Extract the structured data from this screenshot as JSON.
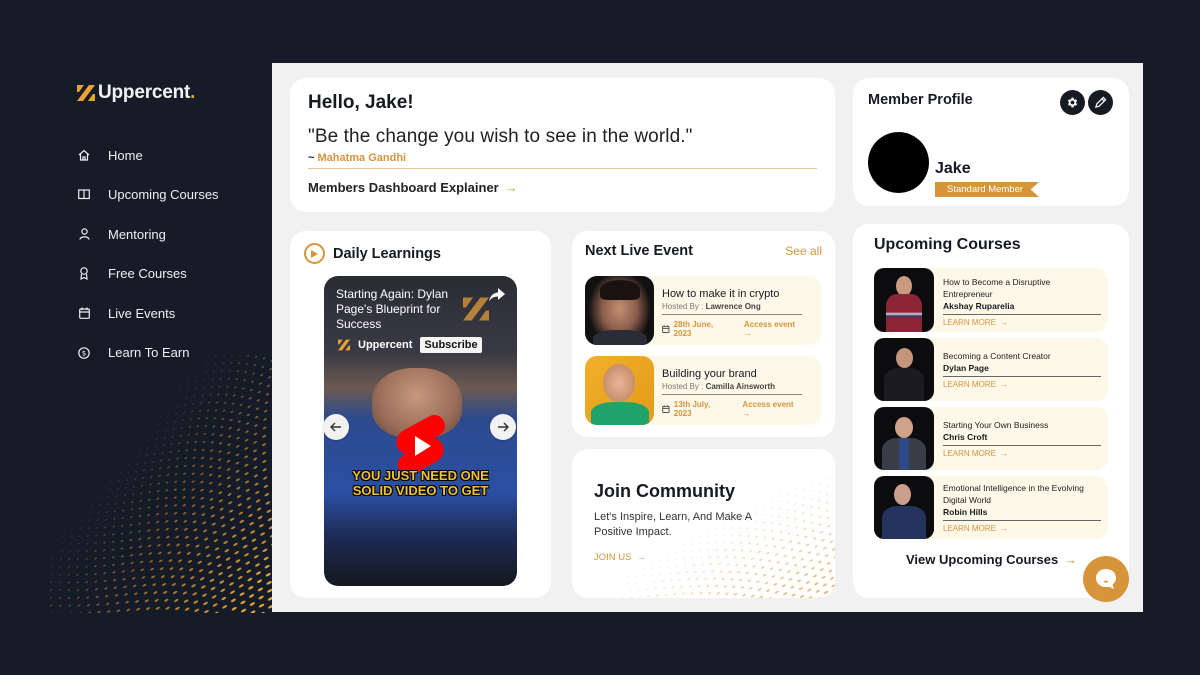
{
  "brand": {
    "name": "Uppercent",
    "accent": "#d7953b",
    "dark": "#161c27"
  },
  "sidebar": {
    "items": [
      {
        "label": "Home",
        "icon": "home-icon"
      },
      {
        "label": "Upcoming Courses",
        "icon": "book-icon"
      },
      {
        "label": "Mentoring",
        "icon": "user-icon"
      },
      {
        "label": "Free Courses",
        "icon": "award-icon"
      },
      {
        "label": "Live Events",
        "icon": "calendar-icon"
      },
      {
        "label": "Learn To Earn",
        "icon": "dollar-coin-icon"
      }
    ]
  },
  "hello": {
    "greeting": "Hello, Jake!",
    "quote": "\"Be the change you wish to see in the world.\"",
    "author_prefix": "~ ",
    "author": "Mahatma Gandhi",
    "explainer": "Members Dashboard Explainer"
  },
  "profile": {
    "title": "Member Profile",
    "name": "Jake",
    "badge": "Standard Member"
  },
  "daily": {
    "title": "Daily Learnings",
    "video_title": "Starting Again: Dylan Page's Blueprint for Success",
    "channel": "Uppercent",
    "subscribe": "Subscribe",
    "caption_line1": "YOU JUST NEED ONE",
    "caption_line2": "SOLID VIDEO TO GET"
  },
  "events": {
    "title": "Next Live Event",
    "see_all": "See all",
    "host_prefix": "Hosted By : ",
    "items": [
      {
        "title": "How to make it in crypto",
        "host": "Lawrence Ong",
        "date": "28th June, 2023",
        "action": "Access event"
      },
      {
        "title": "Building your brand",
        "host": "Camilla Ainsworth",
        "date": "13th July, 2023",
        "action": "Access event"
      }
    ]
  },
  "community": {
    "title": "Join Community",
    "text": "Let's Inspire, Learn, And Make A Positive Impact.",
    "cta": "JOIN US"
  },
  "courses": {
    "title": "Upcoming Courses",
    "learn_more": "LEARN MORE",
    "items": [
      {
        "title": "How to Become a Disruptive Entrepreneur",
        "author": "Akshay Ruparelia"
      },
      {
        "title": "Becoming a Content Creator",
        "author": "Dylan Page"
      },
      {
        "title": "Starting Your Own Business",
        "author": "Chris Croft"
      },
      {
        "title": "Emotional Intelligence in the Evolving Digital World",
        "author": "Robin Hills"
      }
    ],
    "view_all": "View Upcoming Courses"
  }
}
